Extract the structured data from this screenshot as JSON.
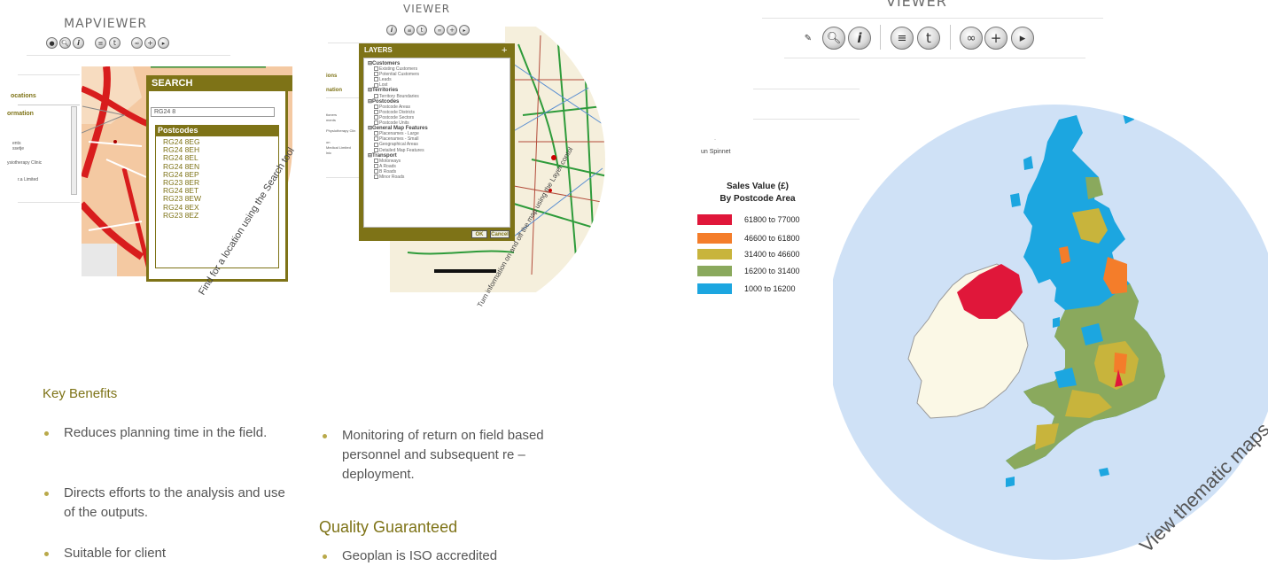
{
  "map1": {
    "title": "MAPVIEWER",
    "panel_items": [
      "ocations",
      "ormation"
    ],
    "panel_small": [
      "ents",
      "ssetje",
      "ysiotherapy Clinic",
      "r.a Limited"
    ],
    "search": {
      "title": "SEARCH",
      "input_value": "RG24 8",
      "results_header": "Postcodes",
      "results": [
        "RG24 8EG",
        "RG24 8EH",
        "RG24 8EL",
        "RG24 8EN",
        "RG24 8EP",
        "RG23 8ER",
        "RG24 8ET",
        "RG23 8EW",
        "RG24 8EX",
        "RG23 8EZ"
      ]
    },
    "caption": "Find for a location using the Search tool"
  },
  "map2": {
    "title_fragment": "VIEWER",
    "panel_items": [
      "ions",
      "nation"
    ],
    "panel_small": [
      "tioners",
      "ments",
      "Physiotherapy Clin",
      "on",
      "Medical Limited",
      "lnic"
    ],
    "layers": {
      "title": "LAYERS",
      "plus": "+",
      "groups": [
        {
          "name": "Customers",
          "items": [
            "Existing Customers",
            "Potential Customers",
            "Leads",
            "Lost"
          ]
        },
        {
          "name": "Territories",
          "items": [
            "Territory Boundaries"
          ]
        },
        {
          "name": "Postcodes",
          "items": [
            "Postcode Areas",
            "Postcode Districts",
            "Postcode Sectors",
            "Postcode Units"
          ]
        },
        {
          "name": "General Map Features",
          "items": [
            "Placenames - Large",
            "Placenames - Small",
            "Geographical Areas",
            "Detailed Map Features"
          ]
        },
        {
          "name": "Transport",
          "items": [
            "Motorways",
            "A Roads",
            "B Roads",
            "Minor Roads"
          ]
        }
      ],
      "ok": "OK",
      "cancel": "Cancel"
    },
    "caption": "Turn information on and off the map using the Layer contol"
  },
  "map3": {
    "title_fragment": "VIEWER",
    "panel_small": "un Spinnet",
    "legend": {
      "title_line1": "Sales Value (£)",
      "title_line2": "By Postcode Area",
      "rows": [
        {
          "label": "61800 to 77000",
          "color": "#e0173a"
        },
        {
          "label": "46600 to 61800",
          "color": "#f47d2a"
        },
        {
          "label": "31400 to 46600",
          "color": "#c8b43c"
        },
        {
          "label": "16200 to 31400",
          "color": "#8aa95d"
        },
        {
          "label": "1000 to 16200",
          "color": "#1ca6e0"
        }
      ]
    },
    "caption": "View thematic maps"
  },
  "key_benefits": {
    "heading": "Key Benefits",
    "col1": [
      "Reduces planning time in the field.",
      "Directs efforts to the analysis and use of the outputs.",
      "Suitable for client"
    ],
    "col2": [
      "Monitoring of return on field based personnel and subsequent re –deployment."
    ]
  },
  "quality": {
    "heading": "Quality Guaranteed",
    "items": [
      "Geoplan is ISO accredited"
    ]
  },
  "colors": {
    "accent": "#7e7317",
    "sea": "#cfe1f6",
    "ireland": "#fbf8e6"
  },
  "icons": [
    "pointer-icon",
    "zoom-icon",
    "info-icon",
    "layers-icon",
    "text-icon",
    "binoculars-icon",
    "zoom-in-icon",
    "export-icon"
  ]
}
